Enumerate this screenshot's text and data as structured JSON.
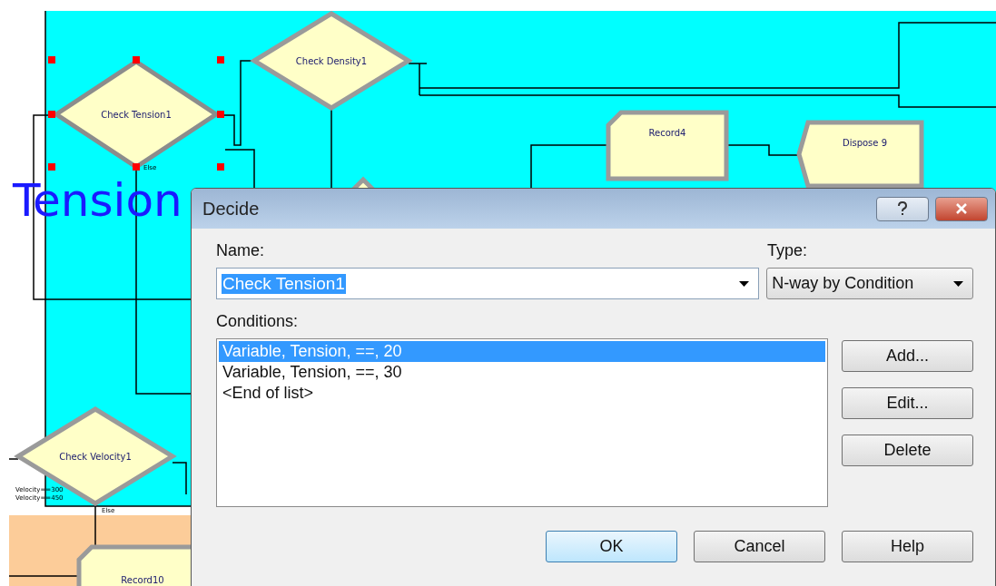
{
  "canvas": {
    "annotation": [
      "Tension"
    ],
    "modules": [
      {
        "kind": "decide",
        "label": "Check Tension1",
        "selected": true,
        "else_label": "Else"
      },
      {
        "kind": "decide",
        "label": "Check Density1",
        "selected": false
      },
      {
        "kind": "record",
        "label": "Record4",
        "selected": false
      },
      {
        "kind": "dispose",
        "label": "Dispose 9",
        "selected": false
      },
      {
        "kind": "decide",
        "selected": false
      },
      {
        "kind": "decide",
        "label": "Check Velocity1",
        "selected": false,
        "branch_labels": [
          "Velocity==300",
          "Velocity==450"
        ],
        "else_label": "Else"
      },
      {
        "kind": "record",
        "label": "Record10",
        "selected": false
      }
    ]
  },
  "dialog": {
    "title": "Decide",
    "name_label": "Name:",
    "name_value": "Check Tension1",
    "type_label": "Type:",
    "type_value": "N-way by Condition",
    "conditions_label": "Conditions:",
    "conditions": [
      {
        "text": "Variable, Tension, ==, 20",
        "selected": true
      },
      {
        "text": "Variable, Tension, ==, 30",
        "selected": false
      },
      {
        "text": "<End of list>",
        "selected": false
      }
    ],
    "side_buttons": [
      "Add...",
      "Edit...",
      "Delete"
    ],
    "buttons": [
      {
        "label": "OK",
        "default": true
      },
      {
        "label": "Cancel",
        "default": false
      },
      {
        "label": "Help",
        "default": false
      }
    ]
  }
}
